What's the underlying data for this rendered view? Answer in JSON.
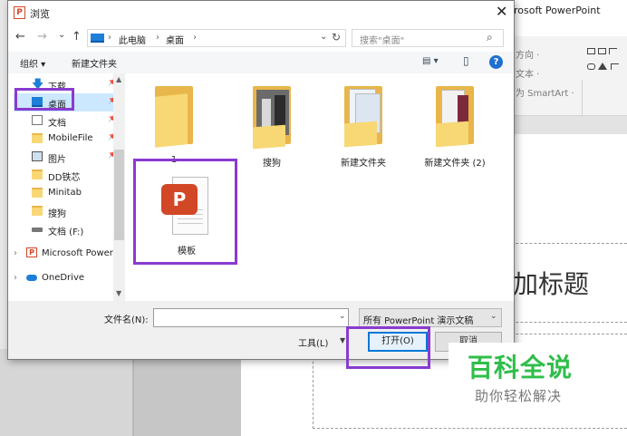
{
  "ppt": {
    "window_title": "rosoft PowerPoint",
    "ribbon": [
      "方向 ·",
      "文本 ·",
      "为 SmartArt ·"
    ],
    "shapes": "▭▯⌐\n▭△⌐\n△↰⌒",
    "slide_title": "加标题"
  },
  "dialog": {
    "app_icon": "P",
    "title": "浏览",
    "close": "✕",
    "nav": {
      "back": "←",
      "forward": "→",
      "recent": "⌄",
      "up": "↑",
      "drop": "⌄",
      "refresh": "↻"
    },
    "breadcrumbs": [
      "此电脑",
      "桌面"
    ],
    "search_placeholder": "搜索\"桌面\"",
    "toolbar": {
      "organize": "组织 ▾",
      "new_folder": "新建文件夹",
      "view_icon": "▤ ▾",
      "pane_icon": "▯"
    },
    "sidebar": [
      {
        "label": "下载",
        "icon": "download-icon",
        "pinned": true
      },
      {
        "label": "桌面",
        "icon": "desktop-icon",
        "pinned": true,
        "selected": true
      },
      {
        "label": "文档",
        "icon": "documents-icon",
        "pinned": true
      },
      {
        "label": "MobileFile",
        "icon": "folder-icon",
        "pinned": true
      },
      {
        "label": "图片",
        "icon": "pictures-icon",
        "pinned": true
      },
      {
        "label": "DD铁芯",
        "icon": "folder-icon"
      },
      {
        "label": "Minitab",
        "icon": "folder-icon"
      },
      {
        "label": "搜狗",
        "icon": "folder-icon"
      },
      {
        "label": "文档 (F:)",
        "icon": "drive-icon"
      },
      {
        "label": "Microsoft Power",
        "icon": "powerpoint-icon",
        "expandable": true
      },
      {
        "label": "OneDrive",
        "icon": "onedrive-icon",
        "expandable": true
      }
    ],
    "files": [
      {
        "name": "1",
        "type": "folder"
      },
      {
        "name": "搜狗",
        "type": "folder-photo"
      },
      {
        "name": "新建文件夹",
        "type": "folder-docs"
      },
      {
        "name": "新建文件夹 (2)",
        "type": "folder-books"
      },
      {
        "name": "模板",
        "type": "pptx"
      }
    ],
    "filename_label": "文件名(N):",
    "filename_value": "",
    "filter": "所有 PowerPoint 演示文稿",
    "tools_label": "工具(L)",
    "open_label": "打开(O)",
    "cancel_label": "取消"
  },
  "watermark": {
    "main": "百科全说",
    "sub": "助你轻松解决"
  },
  "colors": {
    "accent": "#0078d7",
    "highlight": "#8a3bd0",
    "folder": "#f8d775",
    "watermark": "#2fbe4a"
  }
}
